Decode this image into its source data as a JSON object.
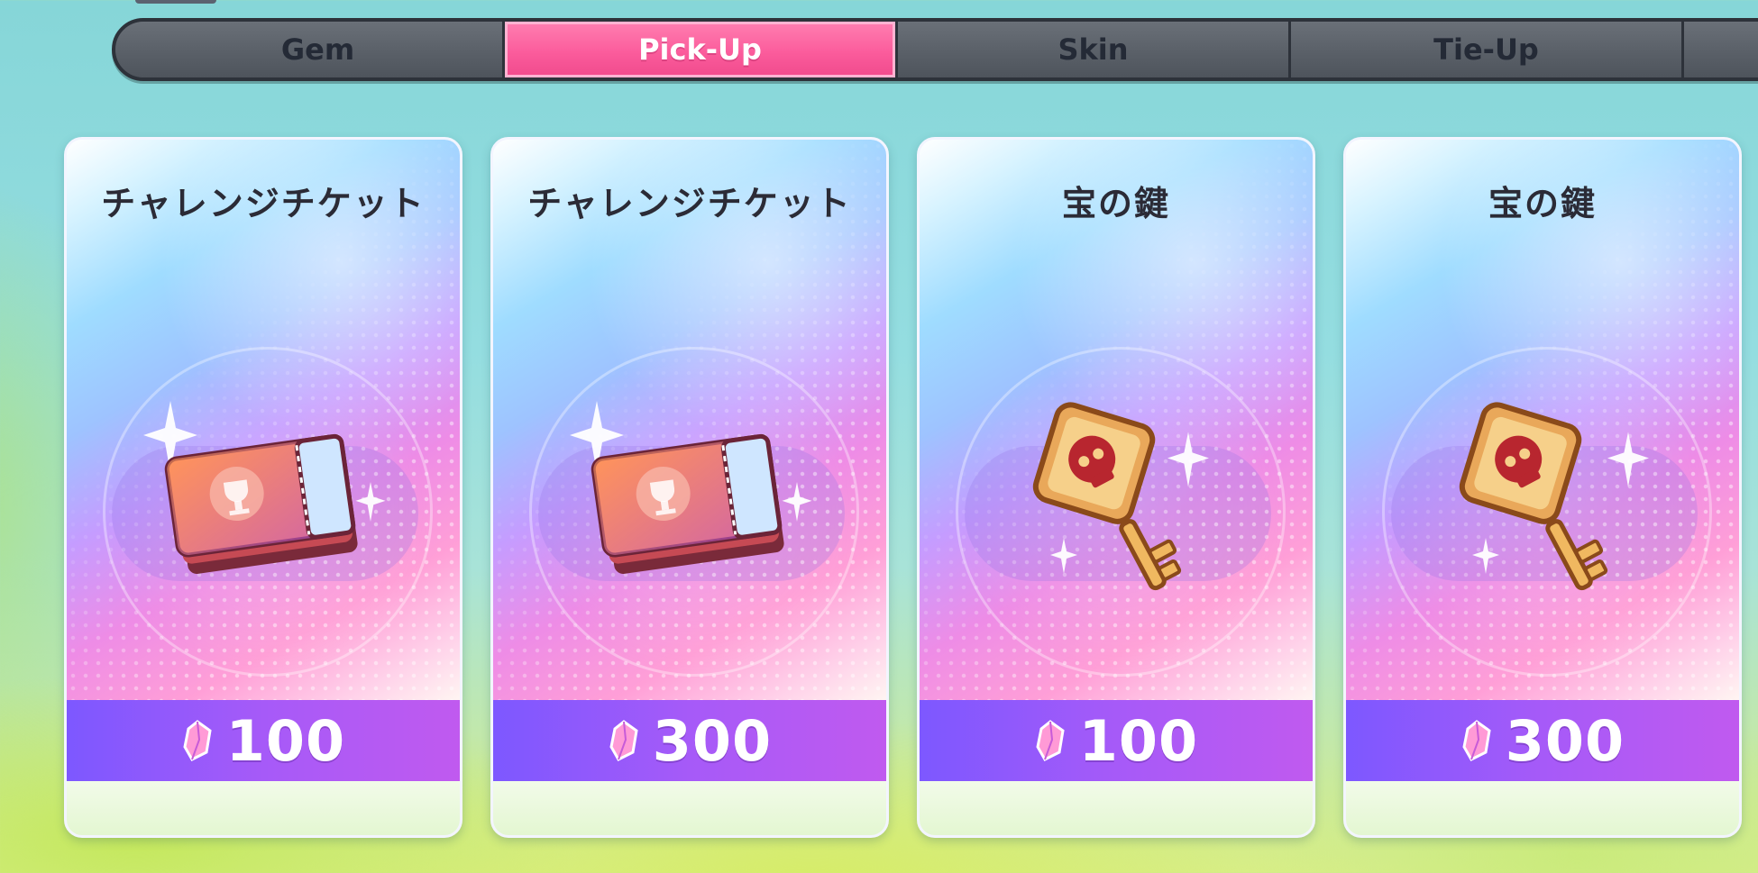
{
  "tabs": [
    {
      "label": "Gem",
      "active": false
    },
    {
      "label": "Pick-Up",
      "active": true
    },
    {
      "label": "Skin",
      "active": false
    },
    {
      "label": "Tie-Up",
      "active": false
    }
  ],
  "cards": [
    {
      "title": "チャレンジチケット",
      "price": "100",
      "icon": "challenge-ticket-icon"
    },
    {
      "title": "チャレンジチケット",
      "price": "300",
      "icon": "challenge-ticket-icon"
    },
    {
      "title": "宝の鍵",
      "price": "100",
      "icon": "treasure-key-icon"
    },
    {
      "title": "宝の鍵",
      "price": "300",
      "icon": "treasure-key-icon"
    }
  ],
  "currency_icon": "gem-currency-icon",
  "colors": {
    "active_tab": "#fb5c9c",
    "inactive_tab": "#5a6068",
    "price_bar": "#a65af8"
  }
}
